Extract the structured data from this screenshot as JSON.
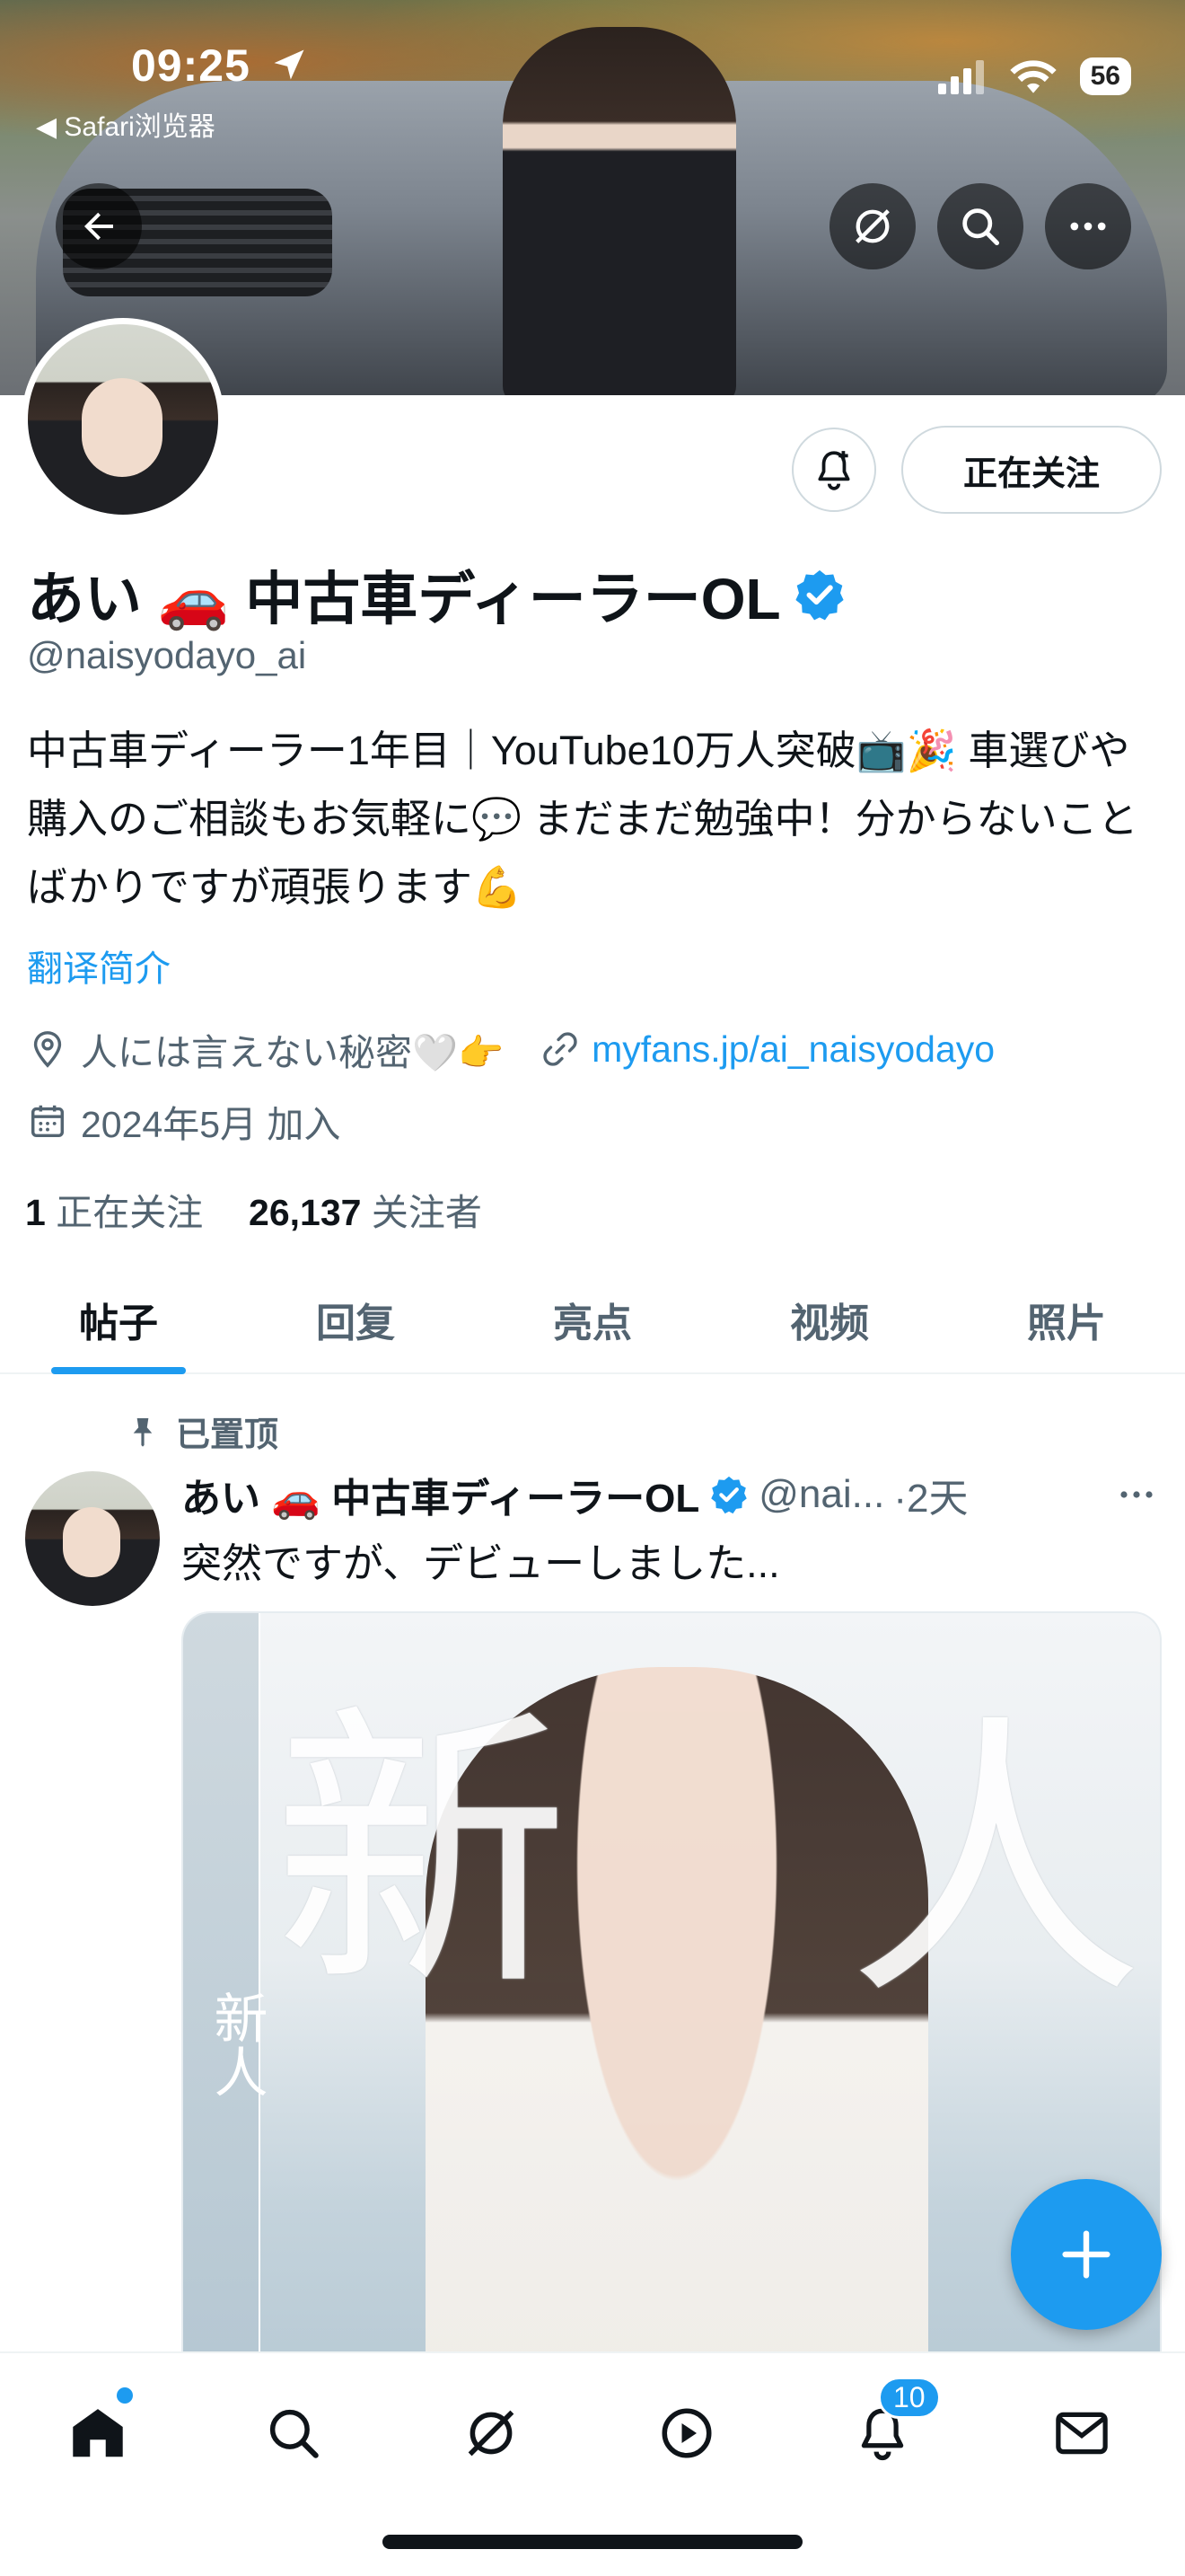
{
  "status_bar": {
    "time": "09:25",
    "back_app": "◀ Safari浏览器",
    "battery": "56"
  },
  "profile": {
    "name": "あい 🚗 中古車ディーラーOL",
    "handle": "@naisyodayo_ai",
    "bio": "中古車ディーラー1年目｜YouTube10万人突破📺🎉 車選びや購入のご相談もお気軽に💬 まだまだ勉強中！分からないことばかりですが頑張ります💪",
    "translate_label": "翻译简介",
    "location": "人には言えない秘密🤍👉",
    "link": "myfans.jp/ai_naisyodayo",
    "joined": "2024年5月 加入",
    "following_count": "1",
    "following_label": "正在关注",
    "followers_count": "26,137",
    "followers_label": "关注者",
    "follow_button": "正在关注",
    "verified_color": "#1d9bf0"
  },
  "tabs": [
    {
      "label": "帖子",
      "active": true
    },
    {
      "label": "回复",
      "active": false
    },
    {
      "label": "亮点",
      "active": false
    },
    {
      "label": "视频",
      "active": false
    },
    {
      "label": "照片",
      "active": false
    }
  ],
  "pinned_tweet": {
    "pinned_label": "已置顶",
    "author_name": "あい 🚗 中古車ディーラーOL",
    "author_handle": "@nai...",
    "time": "·2天",
    "text": "突然ですが、デビューしました...",
    "media_text_big_1": "新",
    "media_text_big_2": "人",
    "media_side_text": "新人"
  },
  "bottom_nav": {
    "notifications_badge": "10"
  },
  "colors": {
    "accent": "#1d9bf0",
    "text_primary": "#0f1419",
    "text_secondary": "#536471"
  }
}
